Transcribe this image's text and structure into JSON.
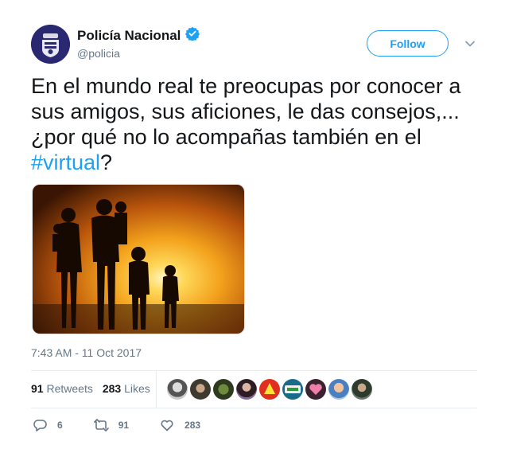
{
  "user": {
    "display_name": "Policía Nacional",
    "handle": "@policia",
    "verified": true
  },
  "follow_label": "Follow",
  "tweet": {
    "text_line1": "En el mundo real te preocupas por conocer a",
    "text_line2": "sus amigos, sus aficiones, le das consejos,...",
    "text_line3": "¿por qué no lo acompañas también en el",
    "hashtag": "#virtual",
    "text_end": "?"
  },
  "timestamp": "7:43 AM - 11 Oct 2017",
  "stats": {
    "retweets_count": "91",
    "retweets_label": "Retweets",
    "likes_count": "283",
    "likes_label": "Likes"
  },
  "actions": {
    "replies": "6",
    "retweets": "91",
    "likes": "283"
  },
  "colors": {
    "accent": "#1da1f2",
    "text": "#14171a",
    "muted": "#657786"
  },
  "icons": [
    "police-crest-icon",
    "verified-badge-icon",
    "chevron-down-icon",
    "reply-icon",
    "retweet-icon",
    "heart-icon"
  ]
}
